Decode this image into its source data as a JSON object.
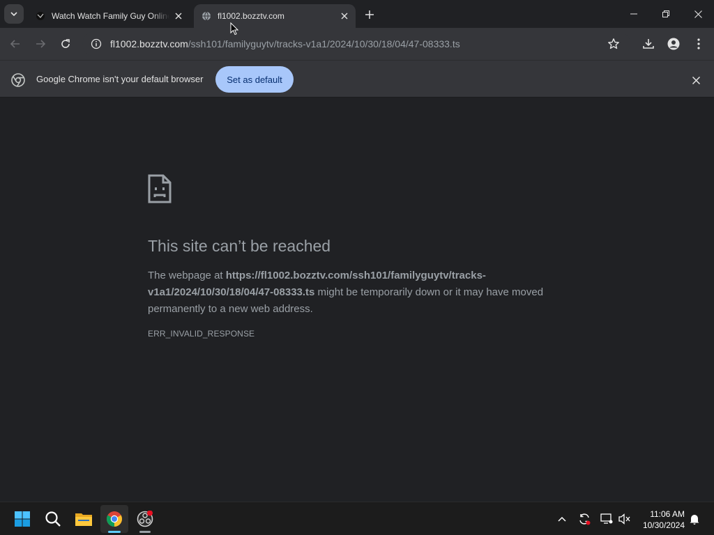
{
  "tabs": [
    {
      "title": "Watch Watch Family Guy Online",
      "active": false
    },
    {
      "title": "fl1002.bozztv.com",
      "active": true
    }
  ],
  "omnibox": {
    "host": "fl1002.bozztv.com",
    "path": "/ssh101/familyguytv/tracks-v1a1/2024/10/30/18/04/47-08333.ts"
  },
  "infobar": {
    "message": "Google Chrome isn't your default browser",
    "button": "Set as default"
  },
  "error": {
    "title": "This site can’t be reached",
    "body_prefix": "The webpage at ",
    "url_line1": "https://fl1002.bozztv.com/ssh101/familyguytv/tracks-",
    "url_line2": "v1a1/2024/10/30/18/04/47-08333.ts",
    "body_suffix": " might be temporarily down or it may have moved permanently to a new web address.",
    "code": "ERR_INVALID_RESPONSE"
  },
  "taskbar": {
    "apps": [
      "start",
      "search",
      "file-explorer",
      "chrome",
      "obs-studio"
    ],
    "time": "11:06 AM",
    "date": "10/30/2024"
  },
  "colors": {
    "page_bg": "#202124",
    "toolbar_bg": "#35363a",
    "accent_button": "#a8c7fa",
    "text_muted": "#9aa0a6"
  }
}
